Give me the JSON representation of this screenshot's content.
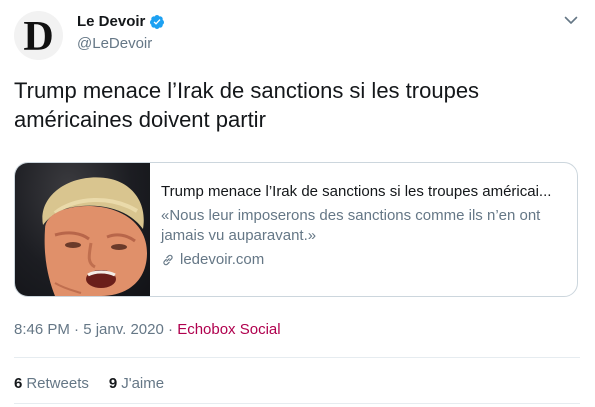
{
  "account": {
    "avatar_letter": "D",
    "display_name": "Le Devoir",
    "handle": "@LeDevoir"
  },
  "tweet": {
    "text": "Trump menace l’Irak de sanctions si les troupes américaines doivent partir"
  },
  "card": {
    "title": "Trump menace l’Irak de sanctions si les troupes américai...",
    "description": "«Nous leur imposerons des sanctions comme ils n’en ont jamais vu auparavant.»",
    "domain": "ledevoir.com",
    "icon": "link-icon"
  },
  "meta": {
    "time": "8:46 PM",
    "separator": "·",
    "date": "5 janv. 2020",
    "source": "Echobox Social"
  },
  "stats": {
    "retweets_count": "6",
    "retweets_label": "Retweets",
    "likes_count": "9",
    "likes_label": "J'aime"
  },
  "colors": {
    "verified": "#1da1f2",
    "secondary_text": "#657786",
    "source_link": "#b0004e"
  },
  "icons": [
    "verified-badge-icon",
    "chevron-down-icon",
    "link-icon"
  ]
}
